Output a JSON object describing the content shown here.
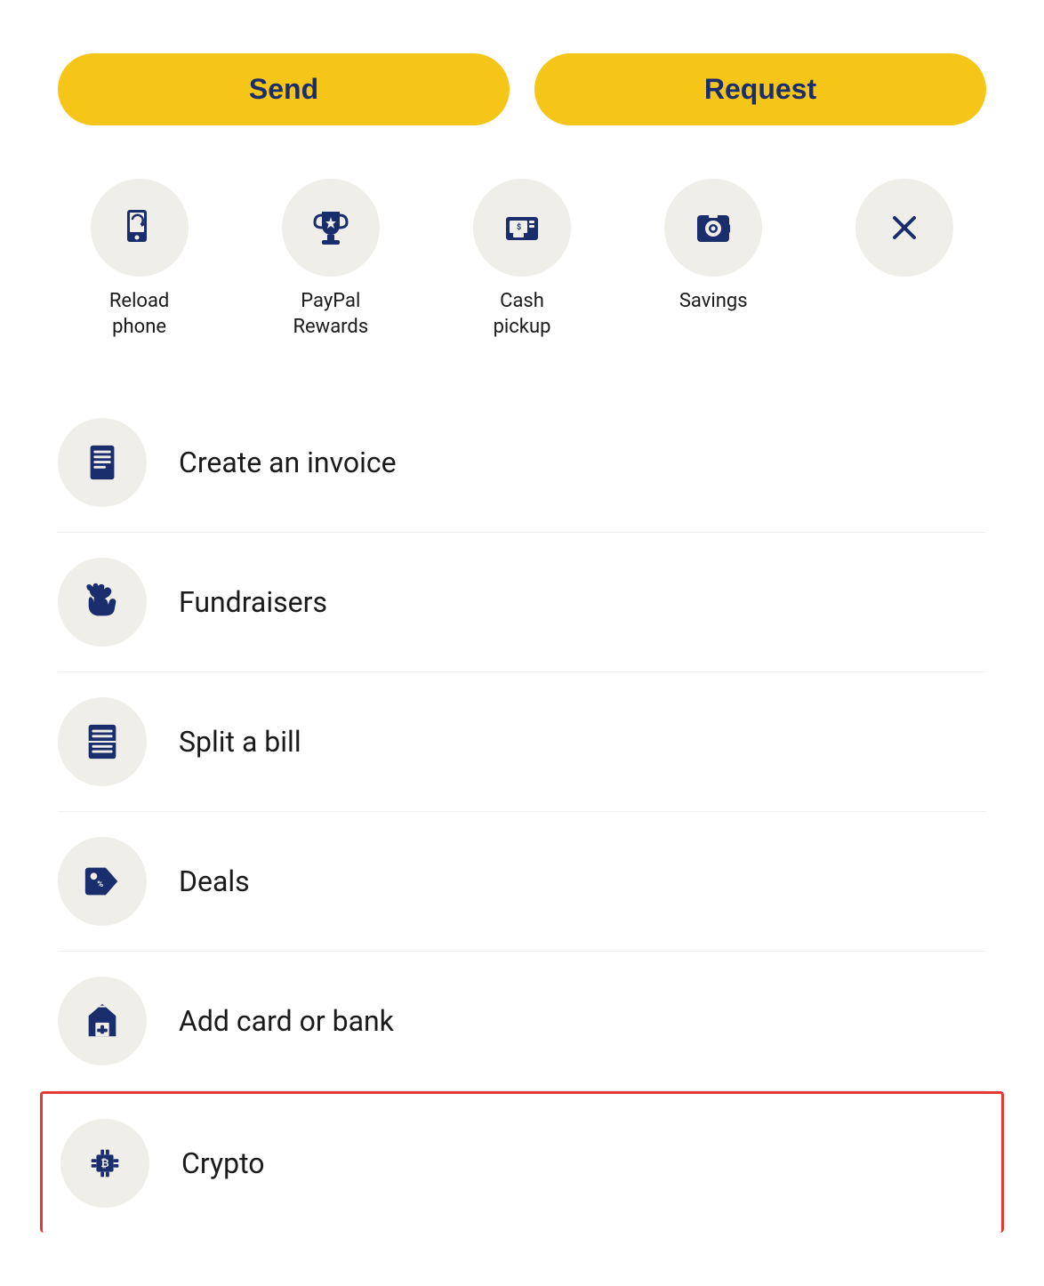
{
  "buttons": {
    "send": "Send",
    "request": "Request"
  },
  "quickActions": [
    {
      "id": "reload-phone",
      "label": "Reload\nphone",
      "icon": "phone-reload"
    },
    {
      "id": "paypal-rewards",
      "label": "PayPal\nRewards",
      "icon": "trophy"
    },
    {
      "id": "cash-pickup",
      "label": "Cash\npickup",
      "icon": "cash-pickup"
    },
    {
      "id": "savings",
      "label": "Savings",
      "icon": "savings"
    },
    {
      "id": "close",
      "label": "",
      "icon": "close"
    }
  ],
  "listItems": [
    {
      "id": "create-invoice",
      "label": "Create an invoice",
      "icon": "invoice",
      "highlighted": false
    },
    {
      "id": "fundraisers",
      "label": "Fundraisers",
      "icon": "fundraisers",
      "highlighted": false
    },
    {
      "id": "split-bill",
      "label": "Split a bill",
      "icon": "split-bill",
      "highlighted": false
    },
    {
      "id": "deals",
      "label": "Deals",
      "icon": "deals",
      "highlighted": false
    },
    {
      "id": "add-card-bank",
      "label": "Add card or bank",
      "icon": "add-card",
      "highlighted": false
    },
    {
      "id": "crypto",
      "label": "Crypto",
      "icon": "crypto",
      "highlighted": true
    }
  ]
}
